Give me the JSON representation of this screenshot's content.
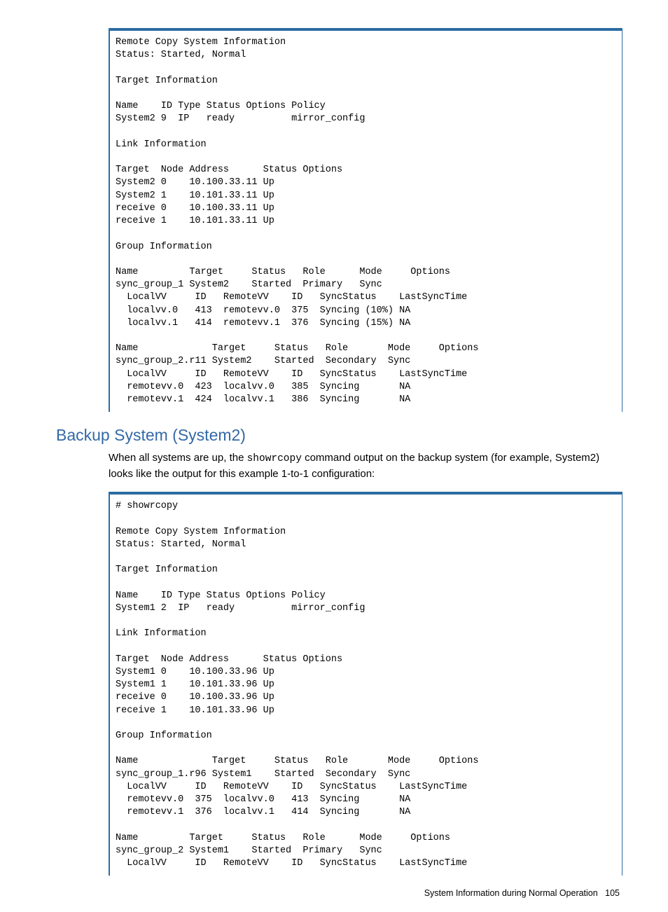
{
  "codeblock1": "Remote Copy System Information\nStatus: Started, Normal\n\nTarget Information\n\nName    ID Type Status Options Policy\nSystem2 9  IP   ready          mirror_config\n\nLink Information\n\nTarget  Node Address      Status Options\nSystem2 0    10.100.33.11 Up\nSystem2 1    10.101.33.11 Up\nreceive 0    10.100.33.11 Up\nreceive 1    10.101.33.11 Up\n\nGroup Information\n\nName         Target     Status   Role      Mode     Options\nsync_group_1 System2    Started  Primary   Sync\n  LocalVV     ID   RemoteVV    ID   SyncStatus    LastSyncTime\n  localvv.0   413  remotevv.0  375  Syncing (10%) NA\n  localvv.1   414  remotevv.1  376  Syncing (15%) NA\n\nName             Target     Status   Role       Mode     Options\nsync_group_2.r11 System2    Started  Secondary  Sync\n  LocalVV     ID   RemoteVV    ID   SyncStatus    LastSyncTime\n  remotevv.0  423  localvv.0   385  Syncing       NA\n  remotevv.1  424  localvv.1   386  Syncing       NA",
  "section_heading": "Backup System (System2)",
  "paragraph_before": "When all systems are up, the ",
  "paragraph_code": "showrcopy",
  "paragraph_after": " command output on the backup system (for example, System2) looks like the output for this example 1-to-1 configuration:",
  "codeblock2": "# showrcopy\n\nRemote Copy System Information\nStatus: Started, Normal\n\nTarget Information\n\nName    ID Type Status Options Policy\nSystem1 2  IP   ready          mirror_config\n\nLink Information\n\nTarget  Node Address      Status Options\nSystem1 0    10.100.33.96 Up\nSystem1 1    10.101.33.96 Up\nreceive 0    10.100.33.96 Up\nreceive 1    10.101.33.96 Up\n\nGroup Information\n\nName             Target     Status   Role       Mode     Options\nsync_group_1.r96 System1    Started  Secondary  Sync\n  LocalVV     ID   RemoteVV    ID   SyncStatus    LastSyncTime\n  remotevv.0  375  localvv.0   413  Syncing       NA\n  remotevv.1  376  localvv.1   414  Syncing       NA\n\nName         Target     Status   Role      Mode     Options\nsync_group_2 System1    Started  Primary   Sync\n  LocalVV     ID   RemoteVV    ID   SyncStatus    LastSyncTime",
  "footer_text": "System Information during Normal Operation",
  "page_number": "105"
}
